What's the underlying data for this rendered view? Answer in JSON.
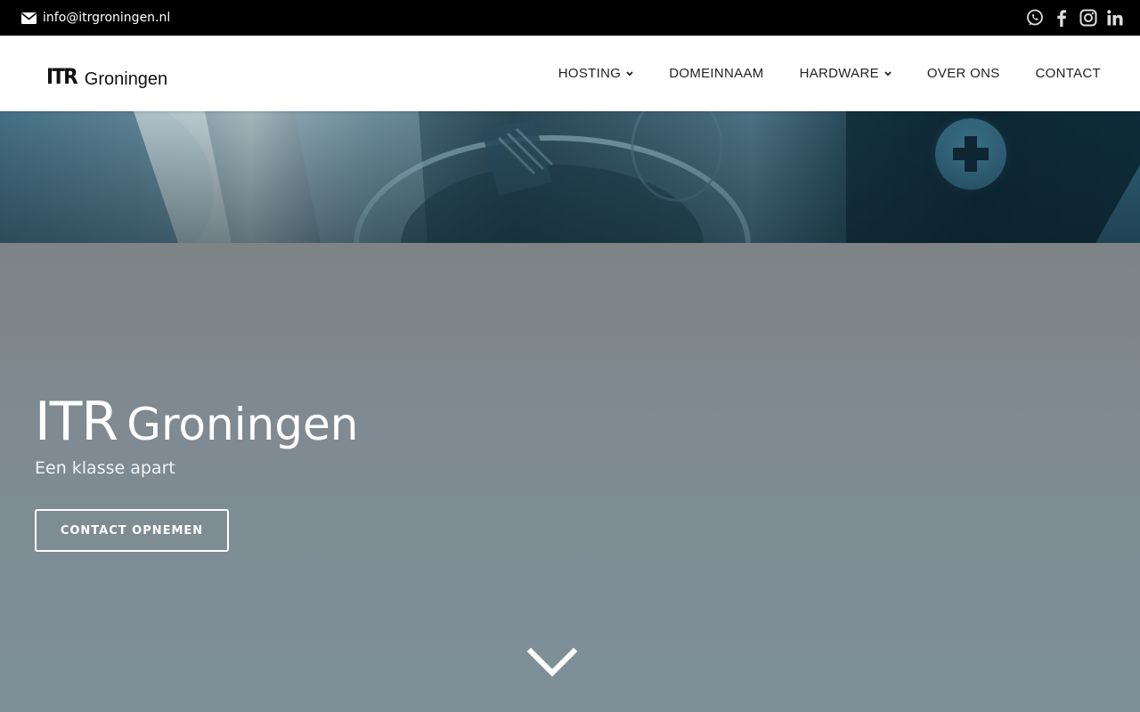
{
  "topbar": {
    "email": "info@itrgroningen.nl",
    "email_icon": "envelope-icon",
    "social": [
      {
        "name": "whatsapp-icon"
      },
      {
        "name": "facebook-icon"
      },
      {
        "name": "instagram-icon"
      },
      {
        "name": "linkedin-icon"
      }
    ]
  },
  "header": {
    "logo_mark": "ITR",
    "logo_word": "Groningen",
    "nav": [
      {
        "label": "HOSTING",
        "has_dropdown": true
      },
      {
        "label": "DOMEINNAAM",
        "has_dropdown": false
      },
      {
        "label": "HARDWARE",
        "has_dropdown": true
      },
      {
        "label": "OVER ONS",
        "has_dropdown": false
      },
      {
        "label": "CONTACT",
        "has_dropdown": false
      }
    ]
  },
  "hero": {
    "title_part1": "ITR",
    "title_part2": "Groningen",
    "subtitle": "Een klasse apart",
    "button_label": "CONTACT OPNEMEN",
    "scroll_icon": "chevron-down-icon"
  },
  "colors": {
    "topbar_bg": "#000000",
    "header_bg": "#ffffff",
    "hero_overlay": "#7f8f98",
    "text_light": "#ffffff",
    "nav_text": "#222222"
  }
}
